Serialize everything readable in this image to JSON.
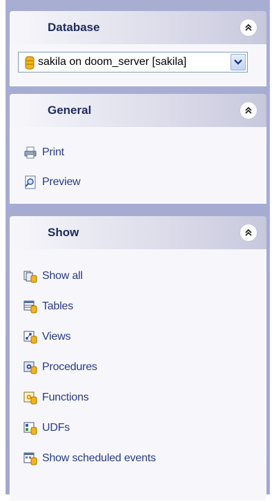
{
  "database": {
    "title": "Database",
    "selected": "sakila on doom_server [sakila]"
  },
  "general": {
    "title": "General",
    "items": [
      {
        "label": "Print",
        "icon": "printer-icon"
      },
      {
        "label": "Preview",
        "icon": "preview-icon"
      }
    ]
  },
  "show": {
    "title": "Show",
    "items": [
      {
        "label": "Show all",
        "icon": "show-all-icon"
      },
      {
        "label": "Tables",
        "icon": "tables-icon"
      },
      {
        "label": "Views",
        "icon": "views-icon"
      },
      {
        "label": "Procedures",
        "icon": "procedures-icon"
      },
      {
        "label": "Functions",
        "icon": "functions-icon"
      },
      {
        "label": "UDFs",
        "icon": "udfs-icon"
      },
      {
        "label": "Show scheduled events",
        "icon": "scheduled-events-icon"
      }
    ]
  },
  "colors": {
    "sidebar": "#a8aed2",
    "header_title": "#1f2a5c",
    "item_text": "#2a3a86"
  }
}
